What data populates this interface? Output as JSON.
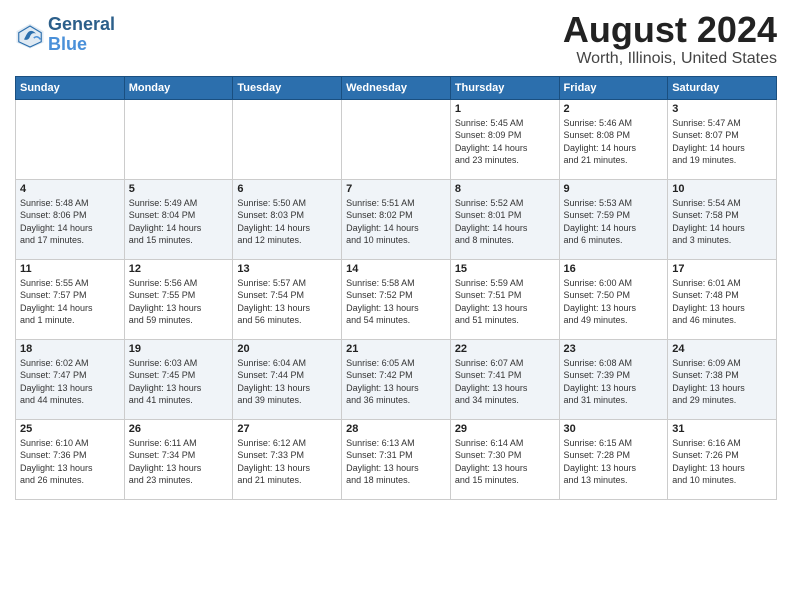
{
  "header": {
    "logo_line1": "General",
    "logo_line2": "Blue",
    "title": "August 2024",
    "subtitle": "Worth, Illinois, United States"
  },
  "columns": [
    "Sunday",
    "Monday",
    "Tuesday",
    "Wednesday",
    "Thursday",
    "Friday",
    "Saturday"
  ],
  "weeks": [
    [
      {
        "day": "",
        "info": ""
      },
      {
        "day": "",
        "info": ""
      },
      {
        "day": "",
        "info": ""
      },
      {
        "day": "",
        "info": ""
      },
      {
        "day": "1",
        "info": "Sunrise: 5:45 AM\nSunset: 8:09 PM\nDaylight: 14 hours\nand 23 minutes."
      },
      {
        "day": "2",
        "info": "Sunrise: 5:46 AM\nSunset: 8:08 PM\nDaylight: 14 hours\nand 21 minutes."
      },
      {
        "day": "3",
        "info": "Sunrise: 5:47 AM\nSunset: 8:07 PM\nDaylight: 14 hours\nand 19 minutes."
      }
    ],
    [
      {
        "day": "4",
        "info": "Sunrise: 5:48 AM\nSunset: 8:06 PM\nDaylight: 14 hours\nand 17 minutes."
      },
      {
        "day": "5",
        "info": "Sunrise: 5:49 AM\nSunset: 8:04 PM\nDaylight: 14 hours\nand 15 minutes."
      },
      {
        "day": "6",
        "info": "Sunrise: 5:50 AM\nSunset: 8:03 PM\nDaylight: 14 hours\nand 12 minutes."
      },
      {
        "day": "7",
        "info": "Sunrise: 5:51 AM\nSunset: 8:02 PM\nDaylight: 14 hours\nand 10 minutes."
      },
      {
        "day": "8",
        "info": "Sunrise: 5:52 AM\nSunset: 8:01 PM\nDaylight: 14 hours\nand 8 minutes."
      },
      {
        "day": "9",
        "info": "Sunrise: 5:53 AM\nSunset: 7:59 PM\nDaylight: 14 hours\nand 6 minutes."
      },
      {
        "day": "10",
        "info": "Sunrise: 5:54 AM\nSunset: 7:58 PM\nDaylight: 14 hours\nand 3 minutes."
      }
    ],
    [
      {
        "day": "11",
        "info": "Sunrise: 5:55 AM\nSunset: 7:57 PM\nDaylight: 14 hours\nand 1 minute."
      },
      {
        "day": "12",
        "info": "Sunrise: 5:56 AM\nSunset: 7:55 PM\nDaylight: 13 hours\nand 59 minutes."
      },
      {
        "day": "13",
        "info": "Sunrise: 5:57 AM\nSunset: 7:54 PM\nDaylight: 13 hours\nand 56 minutes."
      },
      {
        "day": "14",
        "info": "Sunrise: 5:58 AM\nSunset: 7:52 PM\nDaylight: 13 hours\nand 54 minutes."
      },
      {
        "day": "15",
        "info": "Sunrise: 5:59 AM\nSunset: 7:51 PM\nDaylight: 13 hours\nand 51 minutes."
      },
      {
        "day": "16",
        "info": "Sunrise: 6:00 AM\nSunset: 7:50 PM\nDaylight: 13 hours\nand 49 minutes."
      },
      {
        "day": "17",
        "info": "Sunrise: 6:01 AM\nSunset: 7:48 PM\nDaylight: 13 hours\nand 46 minutes."
      }
    ],
    [
      {
        "day": "18",
        "info": "Sunrise: 6:02 AM\nSunset: 7:47 PM\nDaylight: 13 hours\nand 44 minutes."
      },
      {
        "day": "19",
        "info": "Sunrise: 6:03 AM\nSunset: 7:45 PM\nDaylight: 13 hours\nand 41 minutes."
      },
      {
        "day": "20",
        "info": "Sunrise: 6:04 AM\nSunset: 7:44 PM\nDaylight: 13 hours\nand 39 minutes."
      },
      {
        "day": "21",
        "info": "Sunrise: 6:05 AM\nSunset: 7:42 PM\nDaylight: 13 hours\nand 36 minutes."
      },
      {
        "day": "22",
        "info": "Sunrise: 6:07 AM\nSunset: 7:41 PM\nDaylight: 13 hours\nand 34 minutes."
      },
      {
        "day": "23",
        "info": "Sunrise: 6:08 AM\nSunset: 7:39 PM\nDaylight: 13 hours\nand 31 minutes."
      },
      {
        "day": "24",
        "info": "Sunrise: 6:09 AM\nSunset: 7:38 PM\nDaylight: 13 hours\nand 29 minutes."
      }
    ],
    [
      {
        "day": "25",
        "info": "Sunrise: 6:10 AM\nSunset: 7:36 PM\nDaylight: 13 hours\nand 26 minutes."
      },
      {
        "day": "26",
        "info": "Sunrise: 6:11 AM\nSunset: 7:34 PM\nDaylight: 13 hours\nand 23 minutes."
      },
      {
        "day": "27",
        "info": "Sunrise: 6:12 AM\nSunset: 7:33 PM\nDaylight: 13 hours\nand 21 minutes."
      },
      {
        "day": "28",
        "info": "Sunrise: 6:13 AM\nSunset: 7:31 PM\nDaylight: 13 hours\nand 18 minutes."
      },
      {
        "day": "29",
        "info": "Sunrise: 6:14 AM\nSunset: 7:30 PM\nDaylight: 13 hours\nand 15 minutes."
      },
      {
        "day": "30",
        "info": "Sunrise: 6:15 AM\nSunset: 7:28 PM\nDaylight: 13 hours\nand 13 minutes."
      },
      {
        "day": "31",
        "info": "Sunrise: 6:16 AM\nSunset: 7:26 PM\nDaylight: 13 hours\nand 10 minutes."
      }
    ]
  ]
}
